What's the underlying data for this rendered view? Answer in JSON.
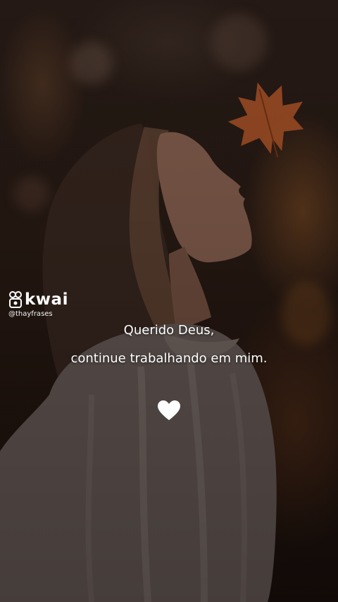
{
  "watermark": {
    "brand": "kwai",
    "handle": "@thayfrases",
    "logo_icon": "kwai-logo-icon"
  },
  "quote": {
    "line1": "Querido Deus,",
    "line2": "continue trabalhando em mim."
  },
  "decoration": {
    "heart_icon": "white-heart-icon",
    "leaf_icon": "autumn-maple-leaf",
    "heart_color": "#ffffff",
    "leaf_color": "#b85a2a"
  }
}
